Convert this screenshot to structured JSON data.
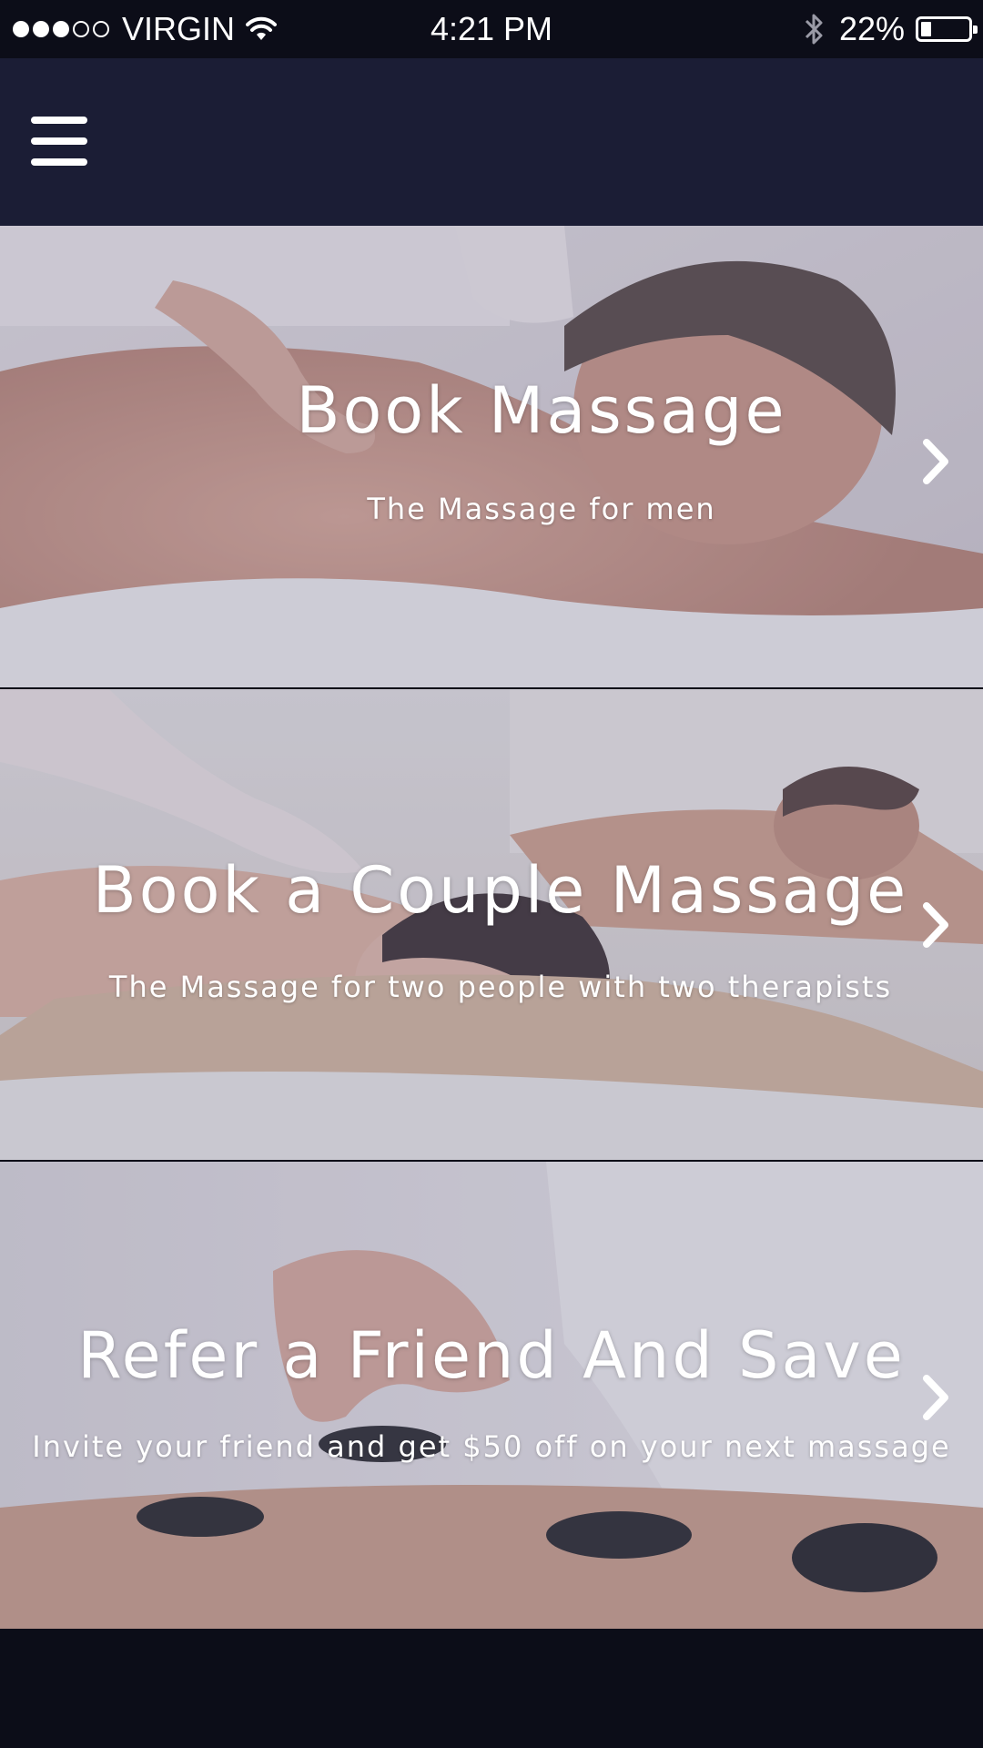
{
  "status_bar": {
    "carrier": "VIRGIN",
    "signal_bars_filled": 3,
    "signal_bars_total": 5,
    "time": "4:21 PM",
    "battery_percent": "22%",
    "battery_level": 0.22,
    "icons": [
      "wifi-icon",
      "bluetooth-icon",
      "battery-icon"
    ]
  },
  "nav": {
    "menu_icon": "hamburger-menu-icon"
  },
  "cards": [
    {
      "title": "Book Massage",
      "subtitle": "The Massage for men",
      "icon": "chevron-right-icon"
    },
    {
      "title": "Book a Couple Massage",
      "subtitle": "The Massage for two people with two therapists",
      "icon": "chevron-right-icon"
    },
    {
      "title": "Refer a Friend And Save",
      "subtitle": "Invite your friend and get $50 off on your next massage",
      "icon": "chevron-right-icon"
    }
  ],
  "colors": {
    "status_bar_bg": "#0c0d18",
    "nav_bg": "#1b1d35",
    "overlay": "#78769a",
    "text": "#ffffff"
  }
}
